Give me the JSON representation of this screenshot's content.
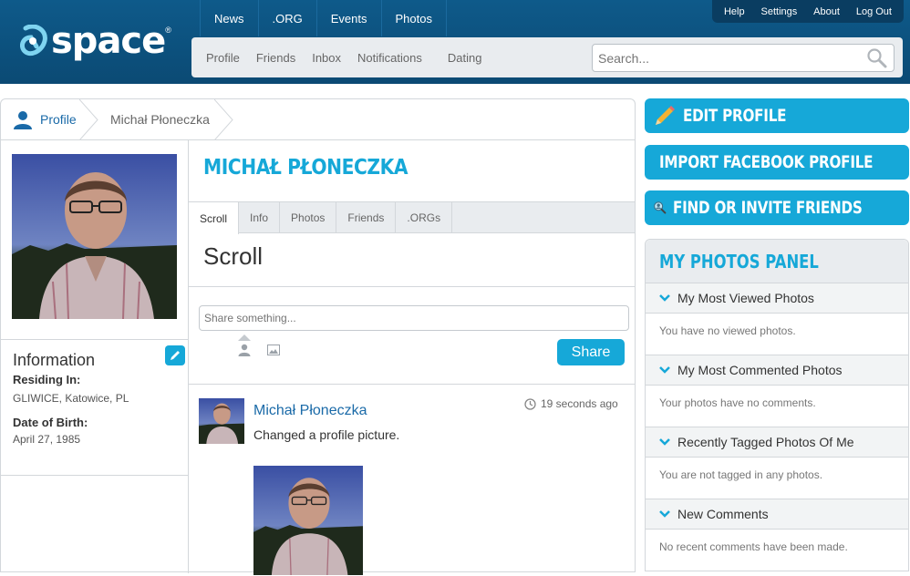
{
  "logo": {
    "text": "space",
    "reg": "®"
  },
  "topnav": [
    "News",
    ".ORG",
    "Events",
    "Photos"
  ],
  "utility": [
    "Help",
    "Settings",
    "About",
    "Log Out"
  ],
  "subnav": [
    "Profile",
    "Friends",
    "Inbox",
    "Notifications",
    "Dating"
  ],
  "search": {
    "placeholder": "Search..."
  },
  "breadcrumb": {
    "profile": "Profile",
    "name": "Michał Płoneczka"
  },
  "profile": {
    "name": "MICHAŁ PŁONECZKA"
  },
  "info": {
    "title": "Information",
    "residing_label": "Residing In:",
    "residing_value": "GLIWICE, Katowice, PL",
    "dob_label": "Date of Birth:",
    "dob_value": "April 27, 1985"
  },
  "tabs": [
    "Scroll",
    "Info",
    "Photos",
    "Friends",
    ".ORGs"
  ],
  "section_title": "Scroll",
  "share": {
    "placeholder": "Share something...",
    "button": "Share"
  },
  "post": {
    "author": "Michał Płoneczka",
    "time": "19 seconds ago",
    "text": "Changed a profile picture."
  },
  "actions": [
    "EDIT PROFILE",
    "IMPORT FACEBOOK PROFILE",
    "FIND OR INVITE FRIENDS"
  ],
  "photos_panel": {
    "title": "MY PHOTOS PANEL",
    "sections": [
      {
        "title": "My Most Viewed Photos",
        "text": "You have no viewed photos."
      },
      {
        "title": "My Most Commented Photos",
        "text": "Your photos have no comments."
      },
      {
        "title": "Recently Tagged Photos Of Me",
        "text": "You are not tagged in any photos."
      },
      {
        "title": "New Comments",
        "text": "No recent comments have been made."
      }
    ]
  },
  "colors": {
    "accent": "#16a8d8",
    "header": "#0d4f7c",
    "link": "#1a6aa8"
  }
}
